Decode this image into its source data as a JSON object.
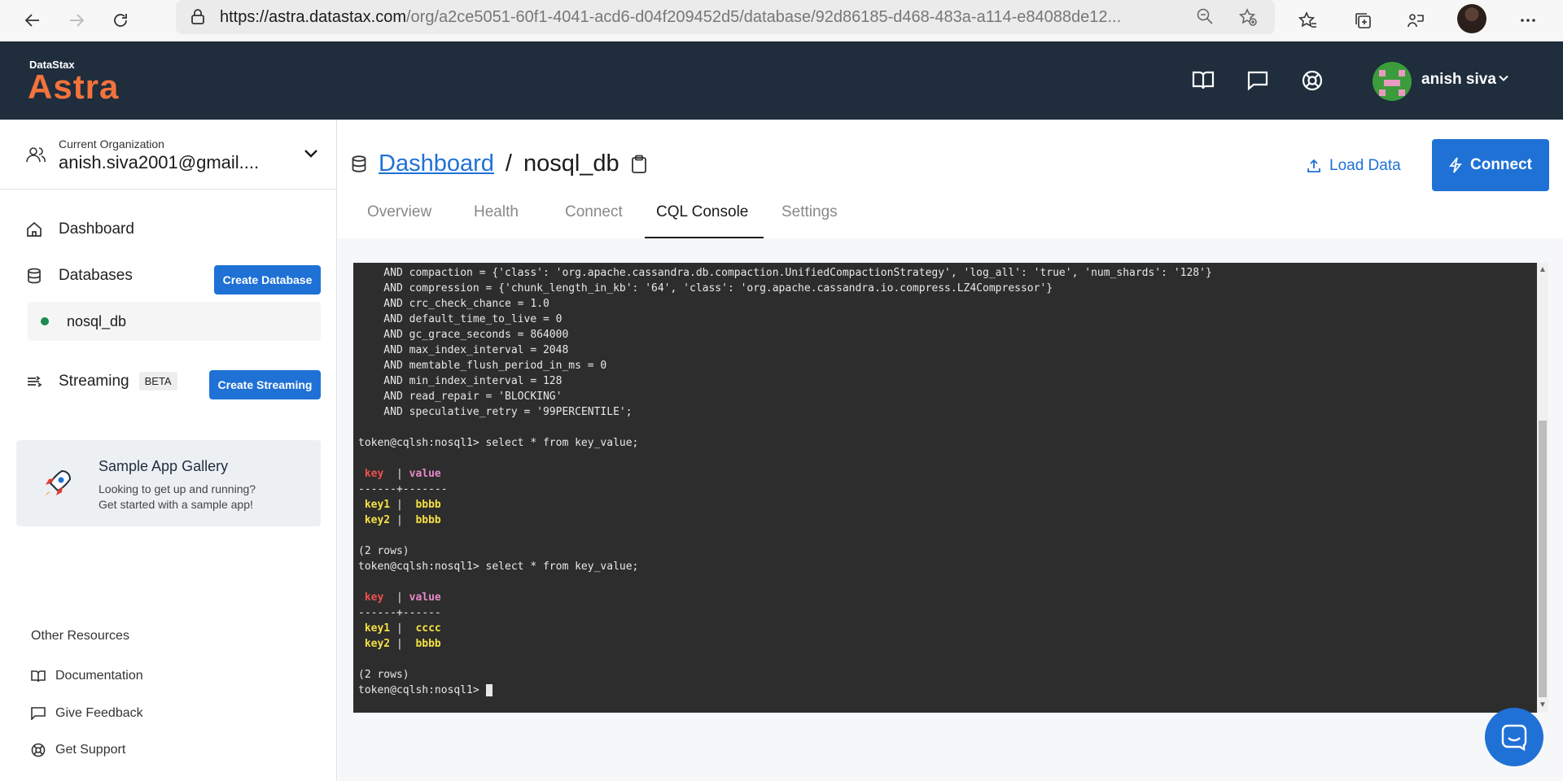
{
  "browser": {
    "url_host": "https://astra.datastax.com",
    "url_path": "/org/a2ce5051-60f1-4041-acd6-d04f209452d5/database/92d86185-d468-483a-a114-e84088de12..."
  },
  "header": {
    "logo_small": "DataStax",
    "logo_big": "Astra",
    "user_name": "anish siva"
  },
  "sidebar": {
    "org_label": "Current Organization",
    "org_value": "anish.siva2001@gmail....",
    "dashboard": "Dashboard",
    "databases": "Databases",
    "create_database": "Create Database",
    "db_item": "nosql_db",
    "streaming": "Streaming",
    "beta": "BETA",
    "create_streaming": "Create Streaming",
    "gallery_title": "Sample App Gallery",
    "gallery_line1": "Looking to get up and running?",
    "gallery_line2": "Get started with a sample app!",
    "resources_title": "Other Resources",
    "documentation": "Documentation",
    "give_feedback": "Give Feedback",
    "get_support": "Get Support"
  },
  "main": {
    "crumb_link": "Dashboard",
    "crumb_sep": "/",
    "crumb_current": "nosql_db",
    "load_data": "Load Data",
    "connect": "Connect",
    "tabs": [
      {
        "label": "Overview"
      },
      {
        "label": "Health"
      },
      {
        "label": "Connect"
      },
      {
        "label": "CQL Console"
      },
      {
        "label": "Settings"
      }
    ]
  },
  "terminal": {
    "lines": [
      "    AND compaction = {'class': 'org.apache.cassandra.db.compaction.UnifiedCompactionStrategy', 'log_all': 'true', 'num_shards': '128'}",
      "    AND compression = {'chunk_length_in_kb': '64', 'class': 'org.apache.cassandra.io.compress.LZ4Compressor'}",
      "    AND crc_check_chance = 1.0",
      "    AND default_time_to_live = 0",
      "    AND gc_grace_seconds = 864000",
      "    AND max_index_interval = 2048",
      "    AND memtable_flush_period_in_ms = 0",
      "    AND min_index_interval = 128",
      "    AND read_repair = 'BLOCKING'",
      "    AND speculative_retry = '99PERCENTILE';",
      "",
      "token@cqlsh:nosql1> select * from key_value;"
    ],
    "result1": {
      "col_key": "key",
      "col_value": "value",
      "divider": "------+-------",
      "rows": [
        {
          "key": "key1",
          "value": "bbbb"
        },
        {
          "key": "key2",
          "value": "bbbb"
        }
      ],
      "count": "(2 rows)"
    },
    "query2": "token@cqlsh:nosql1> select * from key_value;",
    "result2": {
      "col_key": "key",
      "col_value": "value",
      "divider": "------+------",
      "rows": [
        {
          "key": "key1",
          "value": "cccc"
        },
        {
          "key": "key2",
          "value": "bbbb"
        }
      ],
      "count": "(2 rows)"
    },
    "prompt": "token@cqlsh:nosql1> "
  },
  "colors": {
    "accent": "#1f71d6",
    "header_bg": "#1f2d3d",
    "logo": "#f2733c",
    "terminal_bg": "#2d2d2d",
    "status_green": "#1d8a4e"
  },
  "icons": [
    "back-icon",
    "forward-icon",
    "refresh-icon",
    "lock-icon",
    "zoom-icon",
    "favorite-add-icon",
    "favorites-icon",
    "collections-icon",
    "extensions-icon",
    "more-icon",
    "book-icon",
    "chat-icon",
    "support-icon",
    "chevron-down-icon",
    "users-icon",
    "home-icon",
    "database-icon",
    "streaming-icon",
    "rocket-icon",
    "clipboard-icon",
    "upload-icon",
    "bolt-icon",
    "intercom-icon"
  ]
}
